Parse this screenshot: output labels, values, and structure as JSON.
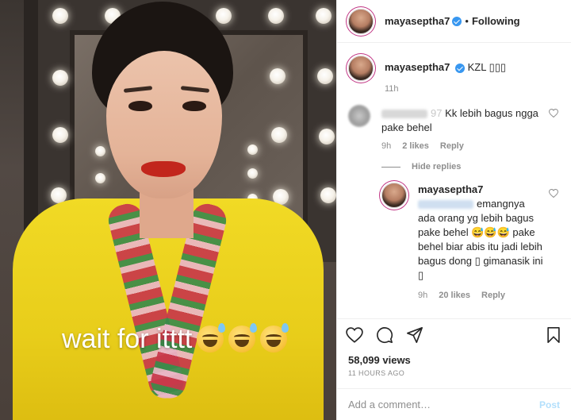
{
  "media": {
    "overlay_caption": "wait for itttt",
    "overlay_emojis": [
      "sweat-smile-emoji",
      "sweat-smile-emoji",
      "sweat-smile-emoji"
    ]
  },
  "header": {
    "username": "mayaseptha7",
    "separator": "•",
    "following_label": "Following"
  },
  "caption": {
    "username": "mayaseptha7",
    "text": "KZL ▯▯▯",
    "time": "11h"
  },
  "comment1": {
    "username_fragment": "97",
    "text": "Kk lebih bagus ngga pake behel",
    "time": "9h",
    "likes": "2 likes",
    "reply_label": "Reply"
  },
  "hide_replies_label": "Hide replies",
  "reply1": {
    "username": "mayaseptha7",
    "text": "emangnya ada orang yg lebih bagus pake behel 😅😅😅 pake behel biar abis itu jadi lebih bagus dong ▯ gimanasik ini ▯",
    "time": "9h",
    "likes": "20 likes",
    "reply_label": "Reply"
  },
  "stats": {
    "views": "58,099 views",
    "time_ago": "11 HOURS AGO"
  },
  "add_comment": {
    "placeholder": "Add a comment…",
    "post_label": "Post"
  },
  "colors": {
    "verified": "#3897f0",
    "secondary_text": "#8e8e8e",
    "post_button_disabled": "#b2dffc",
    "shirt_yellow": "#f1da25",
    "lipstick_red": "#c2261c"
  }
}
